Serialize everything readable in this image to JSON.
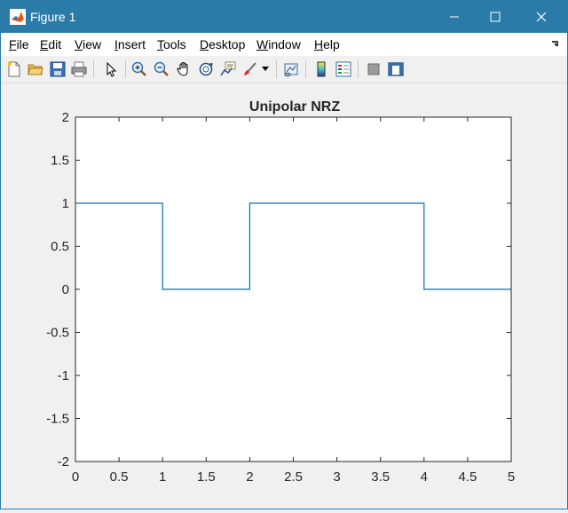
{
  "window": {
    "title": "Figure 1"
  },
  "menu": [
    {
      "label": "File",
      "key": "F",
      "rest": "ile"
    },
    {
      "label": "Edit",
      "key": "E",
      "rest": "dit"
    },
    {
      "label": "View",
      "key": "V",
      "rest": "iew"
    },
    {
      "label": "Insert",
      "key": "I",
      "rest": "nsert"
    },
    {
      "label": "Tools",
      "key": "T",
      "rest": "ools"
    },
    {
      "label": "Desktop",
      "key": "D",
      "rest": "esktop"
    },
    {
      "label": "Window",
      "key": "W",
      "rest": "indow"
    },
    {
      "label": "Help",
      "key": "H",
      "rest": "elp"
    }
  ],
  "toolbar": {
    "icons": [
      "new-figure-icon",
      "open-file-icon",
      "save-icon",
      "print-icon",
      "edit-plot-icon",
      "zoom-in-icon",
      "zoom-out-icon",
      "pan-icon",
      "rotate-3d-icon",
      "data-cursor-icon",
      "brush-icon",
      "link-plot-icon",
      "insert-colorbar-icon",
      "insert-legend-icon",
      "hide-plot-tools-icon",
      "show-plot-tools-icon"
    ]
  },
  "colors": {
    "titlebar": "#2b7ba8",
    "line": "#0072bd"
  },
  "chart_data": {
    "type": "line",
    "step": true,
    "title": "Unipolar NRZ",
    "xlabel": "",
    "ylabel": "",
    "xlim": [
      0,
      5
    ],
    "ylim": [
      -2,
      2
    ],
    "xticks": [
      "0",
      "0.5",
      "1",
      "1.5",
      "2",
      "2.5",
      "3",
      "3.5",
      "4",
      "4.5",
      "5"
    ],
    "yticks": [
      "2",
      "1.5",
      "1",
      "0.5",
      "0",
      "-0.5",
      "-1",
      "-1.5",
      "-2"
    ],
    "grid": false,
    "series": [
      {
        "x": [
          0,
          1,
          1,
          2,
          2,
          4,
          4,
          5
        ],
        "y": [
          1,
          1,
          0,
          0,
          1,
          1,
          0,
          0
        ]
      }
    ]
  }
}
